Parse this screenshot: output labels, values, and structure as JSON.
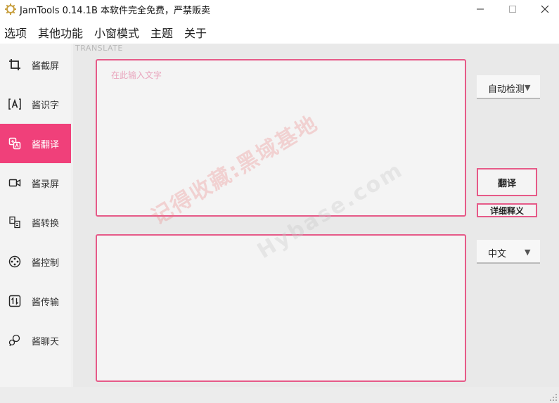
{
  "window": {
    "title": "JamTools 0.14.1B 本软件完全免费，严禁贩卖"
  },
  "menu": {
    "items": [
      "选项",
      "其他功能",
      "小窗模式",
      "主题",
      "关于"
    ]
  },
  "sidebar": {
    "items": [
      {
        "label": "酱截屏",
        "icon": "crop-icon"
      },
      {
        "label": "酱识字",
        "icon": "ocr-icon"
      },
      {
        "label": "酱翻译",
        "icon": "translate-icon"
      },
      {
        "label": "酱录屏",
        "icon": "video-icon"
      },
      {
        "label": "酱转换",
        "icon": "convert-icon"
      },
      {
        "label": "酱控制",
        "icon": "control-icon"
      },
      {
        "label": "酱传输",
        "icon": "transfer-icon"
      },
      {
        "label": "酱聊天",
        "icon": "chat-icon"
      }
    ],
    "active_index": 2
  },
  "translate": {
    "section_label": "TRANSLATE",
    "input_placeholder": "在此输入文字",
    "source_lang": "自动检测",
    "target_lang": "中文",
    "translate_button": "翻译",
    "detail_button": "详细释义"
  },
  "watermark": {
    "line1": "记得收藏:黑域基地",
    "line2": "Hybase.com"
  },
  "colors": {
    "accent": "#f0407a",
    "border_accent": "#e65a88"
  }
}
